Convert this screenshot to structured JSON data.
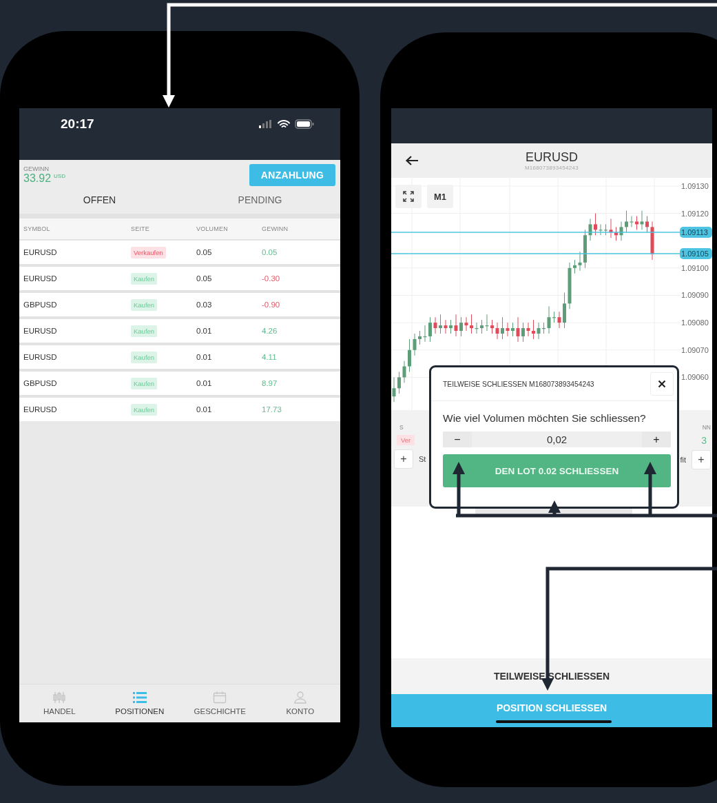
{
  "left_phone": {
    "status_bar": {
      "time": "20:17"
    },
    "profit": {
      "label": "GEWINN",
      "value": "33.92",
      "currency": "USD"
    },
    "deposit_button": "ANZAHLUNG",
    "tabs": [
      {
        "label": "OFFEN",
        "selected": true
      },
      {
        "label": "PENDING",
        "selected": false
      }
    ],
    "table": {
      "columns": [
        "SYMBOL",
        "SEITE",
        "VOLUMEN",
        "GEWINN"
      ],
      "rows": [
        {
          "symbol": "EURUSD",
          "side": "Verkaufen",
          "color": "#fde1e4",
          "volume": "0.05",
          "profit": "0.05",
          "profit_positive": true
        },
        {
          "symbol": "EURUSD",
          "side": "Kaufen",
          "color": "#dcf3e7",
          "volume": "0.05",
          "profit": "-0.30",
          "profit_positive": false
        },
        {
          "symbol": "GBPUSD",
          "side": "Kaufen",
          "color": "#dcf3e7",
          "volume": "0.03",
          "profit": "-0.90",
          "profit_positive": false
        },
        {
          "symbol": "EURUSD",
          "side": "Kaufen",
          "color": "#dcf3e7",
          "volume": "0.01",
          "profit": "4.26",
          "profit_positive": true
        },
        {
          "symbol": "EURUSD",
          "side": "Kaufen",
          "color": "#dcf3e7",
          "volume": "0.01",
          "profit": "4.11",
          "profit_positive": true
        },
        {
          "symbol": "GBPUSD",
          "side": "Kaufen",
          "color": "#dcf3e7",
          "volume": "0.01",
          "profit": "8.97",
          "profit_positive": true
        },
        {
          "symbol": "EURUSD",
          "side": "Kaufen",
          "color": "#dcf3e7",
          "volume": "0.01",
          "profit": "17.73",
          "profit_positive": true
        }
      ]
    },
    "bottom_nav": [
      {
        "label": "HANDEL",
        "kind": "candles",
        "selected": false
      },
      {
        "label": "POSITIONEN",
        "kind": "list",
        "selected": true
      },
      {
        "label": "GESCHICHTE",
        "kind": "calendar",
        "selected": false
      },
      {
        "label": "KONTO",
        "kind": "person",
        "selected": false
      }
    ]
  },
  "right_phone": {
    "header": {
      "title": "EURUSD",
      "subtitle": "M168073893454243"
    },
    "chart": {
      "timeframe": "M1",
      "price_markers": [
        "1.09113",
        "1.09105"
      ],
      "chart_data": {
        "type": "candlestick",
        "ylim": [
          1.09048,
          1.09133
        ],
        "yticks": [
          {
            "value": 1.0913,
            "label": "1.09130"
          },
          {
            "value": 1.0912,
            "label": "1.09120"
          },
          {
            "value": 1.091,
            "label": "1.09100"
          },
          {
            "value": 1.0909,
            "label": "1.09090"
          },
          {
            "value": 1.0908,
            "label": "1.09080"
          },
          {
            "value": 1.0907,
            "label": "1.09070"
          },
          {
            "value": 1.0906,
            "label": "1.09060"
          }
        ],
        "grid": true,
        "ohlc": [
          [
            1.09053,
            1.0906,
            1.09051,
            1.09056
          ],
          [
            1.09056,
            1.09062,
            1.09054,
            1.0906
          ],
          [
            1.0906,
            1.09066,
            1.09058,
            1.09064
          ],
          [
            1.09064,
            1.09074,
            1.09062,
            1.0907
          ],
          [
            1.0907,
            1.09076,
            1.09068,
            1.09074
          ],
          [
            1.09074,
            1.09077,
            1.09072,
            1.09075
          ],
          [
            1.09075,
            1.09079,
            1.09073,
            1.09075
          ],
          [
            1.09075,
            1.09082,
            1.09073,
            1.0908
          ],
          [
            1.0908,
            1.09082,
            1.09076,
            1.09078
          ],
          [
            1.09078,
            1.09083,
            1.09076,
            1.09079
          ],
          [
            1.09079,
            1.09081,
            1.09076,
            1.09078
          ],
          [
            1.09078,
            1.09081,
            1.09076,
            1.09079
          ],
          [
            1.09079,
            1.09083,
            1.09075,
            1.09077
          ],
          [
            1.09077,
            1.09082,
            1.09075,
            1.0908
          ],
          [
            1.0908,
            1.09082,
            1.09077,
            1.09079
          ],
          [
            1.09079,
            1.09083,
            1.09076,
            1.09078
          ],
          [
            1.09078,
            1.0908,
            1.09076,
            1.09078
          ],
          [
            1.09078,
            1.09081,
            1.09076,
            1.09079
          ],
          [
            1.09079,
            1.09083,
            1.09077,
            1.09079
          ],
          [
            1.09079,
            1.09081,
            1.09076,
            1.09078
          ],
          [
            1.09078,
            1.0908,
            1.09074,
            1.09076
          ],
          [
            1.09076,
            1.09082,
            1.09074,
            1.09078
          ],
          [
            1.09078,
            1.0908,
            1.09075,
            1.09077
          ],
          [
            1.09077,
            1.0908,
            1.09075,
            1.09078
          ],
          [
            1.09078,
            1.09082,
            1.09073,
            1.09075
          ],
          [
            1.09075,
            1.0908,
            1.09073,
            1.09078
          ],
          [
            1.09078,
            1.0908,
            1.09075,
            1.09077
          ],
          [
            1.09077,
            1.09081,
            1.09074,
            1.09076
          ],
          [
            1.09076,
            1.0908,
            1.09074,
            1.09078
          ],
          [
            1.09078,
            1.0908,
            1.09076,
            1.09078
          ],
          [
            1.09078,
            1.09086,
            1.09076,
            1.09082
          ],
          [
            1.09082,
            1.09084,
            1.0908,
            1.09082
          ],
          [
            1.09082,
            1.09084,
            1.09078,
            1.0908
          ],
          [
            1.0908,
            1.09091,
            1.09078,
            1.09087
          ],
          [
            1.09087,
            1.09102,
            1.09085,
            1.091
          ],
          [
            1.091,
            1.09103,
            1.09098,
            1.09101
          ],
          [
            1.09101,
            1.09106,
            1.09099,
            1.09102
          ],
          [
            1.09102,
            1.09114,
            1.091,
            1.09112
          ],
          [
            1.09112,
            1.09118,
            1.0911,
            1.09116
          ],
          [
            1.09116,
            1.0912,
            1.09112,
            1.09114
          ],
          [
            1.09114,
            1.09116,
            1.09112,
            1.09114
          ],
          [
            1.09114,
            1.09116,
            1.09112,
            1.09114
          ],
          [
            1.09114,
            1.09118,
            1.09111,
            1.09113
          ],
          [
            1.09113,
            1.09115,
            1.0911,
            1.09112
          ],
          [
            1.09112,
            1.09117,
            1.0911,
            1.09115
          ],
          [
            1.09115,
            1.09121,
            1.09113,
            1.09117
          ],
          [
            1.09117,
            1.09119,
            1.09115,
            1.09117
          ],
          [
            1.09117,
            1.09119,
            1.09114,
            1.09116
          ],
          [
            1.09116,
            1.09121,
            1.09114,
            1.09117
          ],
          [
            1.09117,
            1.09119,
            1.09113,
            1.09115
          ],
          [
            1.09115,
            1.09117,
            1.09103,
            1.09105
          ]
        ]
      }
    },
    "position_panel": {
      "left_label": "S",
      "left_side": "Ver",
      "left_button": "+",
      "left_text": "St",
      "right_label": "NN",
      "right_value": "3",
      "right_text": "fit",
      "right_button": "+"
    },
    "dialog": {
      "title": "TEILWEISE SCHLIESSEN M168073893454243",
      "question": "Wie viel Volumen möchten Sie schliessen?",
      "minus": "−",
      "value": "0,02",
      "plus": "+",
      "confirm": "DEN LOT 0.02 SCHLIESSEN"
    },
    "partial_close_button": "TEILWEISE SCHLIESSEN",
    "close_position_button": "POSITION SCHLIESSEN"
  }
}
